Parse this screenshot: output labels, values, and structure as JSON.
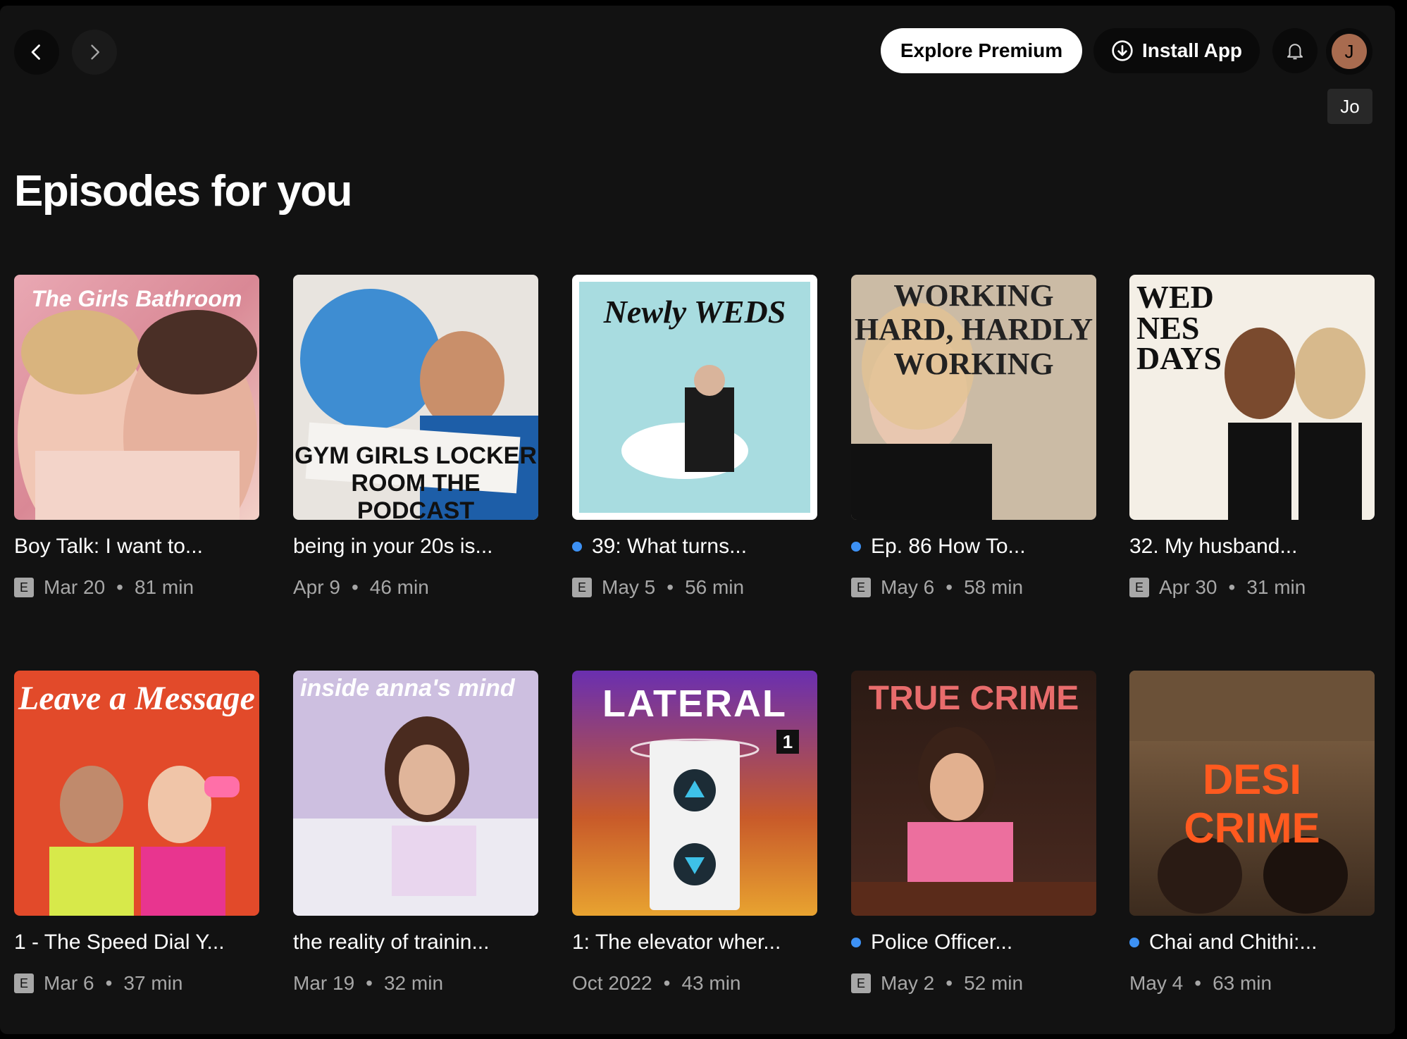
{
  "topbar": {
    "back_icon": "chevron-left-icon",
    "forward_icon": "chevron-right-icon",
    "premium_label": "Explore Premium",
    "install_label": "Install App",
    "bell_icon": "bell-icon",
    "avatar_initial": "J",
    "avatar_tooltip": "Jo"
  },
  "section": {
    "title": "Episodes for you"
  },
  "colors": {
    "background": "#121212",
    "new_dot": "#3d91f4",
    "meta": "#a7a7a7"
  },
  "episodes": [
    {
      "cover_text": "The Girls Bathroom",
      "title": "Boy Talk: I want to...",
      "explicit": true,
      "new": false,
      "date": "Mar 20",
      "duration": "81 min"
    },
    {
      "cover_text": "GYM GIRLS LOCKER ROOM THE PODCAST",
      "title": "being in your 20s is...",
      "explicit": false,
      "new": false,
      "date": "Apr 9",
      "duration": "46 min"
    },
    {
      "cover_text": "Newly WEDS",
      "title": "39: What turns...",
      "explicit": true,
      "new": true,
      "date": "May 5",
      "duration": "56 min"
    },
    {
      "cover_text": "WORKING HARD, HARDLY WORKING",
      "title": "Ep. 86 How To...",
      "explicit": true,
      "new": true,
      "date": "May 6",
      "duration": "58 min"
    },
    {
      "cover_text": "WED NES DAYS",
      "title": "32. My husband...",
      "explicit": true,
      "new": false,
      "date": "Apr 30",
      "duration": "31 min"
    },
    {
      "cover_text": "Leave a Message",
      "title": "1 - The Speed Dial Y...",
      "explicit": true,
      "new": false,
      "date": "Mar 6",
      "duration": "37 min"
    },
    {
      "cover_text": "inside anna's mind",
      "title": "the reality of trainin...",
      "explicit": false,
      "new": false,
      "date": "Mar 19",
      "duration": "32 min"
    },
    {
      "cover_text": "LATERAL",
      "title": "1: The elevator wher...",
      "explicit": false,
      "new": false,
      "date": "Oct 2022",
      "duration": "43 min"
    },
    {
      "cover_text": "TRUE CRIME",
      "title": "Police Officer...",
      "explicit": true,
      "new": true,
      "date": "May 2",
      "duration": "52 min"
    },
    {
      "cover_text": "DESI CRIME",
      "title": "Chai and Chithi:...",
      "explicit": false,
      "new": true,
      "date": "May 4",
      "duration": "63 min"
    }
  ]
}
